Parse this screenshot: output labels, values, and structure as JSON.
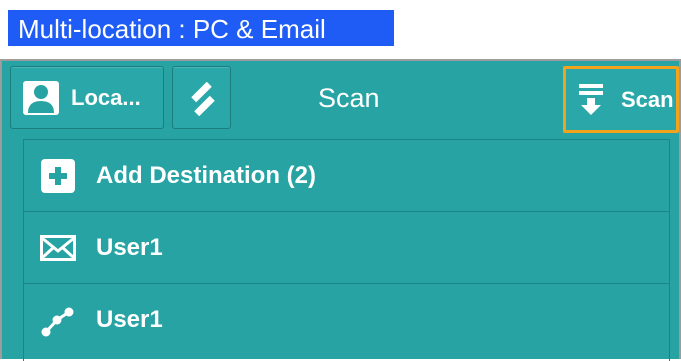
{
  "banner": {
    "text": "Multi-location : PC & Email"
  },
  "toolbar": {
    "login_label": "Loca...",
    "title": "Scan",
    "scan_label": "Scan"
  },
  "destinations": {
    "add": {
      "label": "Add Destination (2)",
      "icon": "plus-icon"
    },
    "items": [
      {
        "label": "User1",
        "icon": "envelope-icon"
      },
      {
        "label": "User1",
        "icon": "network-folder-icon"
      }
    ]
  },
  "colors": {
    "banner": "#1e5cf5",
    "panel": "#27a3a4",
    "scan_highlight": "#f2a31b"
  }
}
